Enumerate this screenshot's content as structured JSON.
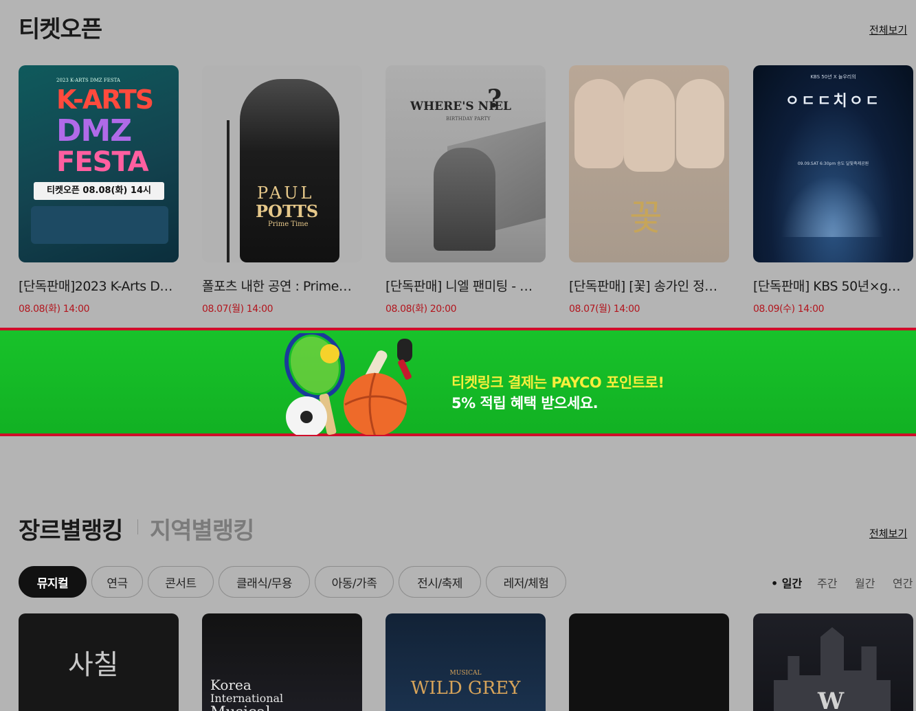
{
  "ticket_open": {
    "title": "티켓오픈",
    "view_all": "전체보기",
    "items": [
      {
        "title": "[단독판매]2023 K-Arts D…",
        "date": "08.08(화) 14:00",
        "poster": {
          "top": "2023 K-ARTS DMZ FESTA",
          "l1": "K-ARTS",
          "l2": "DMZ",
          "l3": "FESTA",
          "open": "티켓오픈 08.08(화) 14시"
        }
      },
      {
        "title": "폴포츠 내한 공연 : Prime…",
        "date": "08.07(월) 14:00",
        "poster": {
          "l1": "PAUL",
          "l2": "POTTS",
          "l3": "Prime Time"
        }
      },
      {
        "title": "[단독판매] 니엘 팬미팅 - …",
        "date": "08.08(화) 20:00",
        "poster": {
          "l1": "WHERE'S NIEL",
          "q": "?",
          "l2": "BIRTHDAY PARTY"
        }
      },
      {
        "title": "[단독판매] [꽃] 송가인 정…",
        "date": "08.07(월) 14:00",
        "poster": {
          "l1": "꽃"
        }
      },
      {
        "title": "[단독판매] KBS 50년×g…",
        "date": "08.09(수) 14:00",
        "poster": {
          "top": "KBS 50년 X 늘우리의",
          "l1": "ㅇㄷㄷ치ㅇㄷ",
          "l2": "09.09.SAT 6:30pm  송도 달빛축제공원"
        }
      }
    ]
  },
  "banner": {
    "line1": "티켓링크 결제는 PAYCO 포인트로!",
    "line2": "5% 적립 혜택 받으세요.",
    "colors": {
      "bg": "#18c22a",
      "border": "#d00d2a",
      "highlight": "#f7ee3c"
    }
  },
  "ranking": {
    "tab_genre": "장르별랭킹",
    "tab_region": "지역별랭킹",
    "view_all": "전체보기",
    "genres": [
      "뮤지컬",
      "연극",
      "콘서트",
      "클래식/무용",
      "아동/가족",
      "전시/축제",
      "레저/체험"
    ],
    "active_genre": "뮤지컬",
    "periods": [
      "• 일간",
      "주간",
      "월간",
      "연간"
    ],
    "active_period": "• 일간",
    "posters": [
      {
        "l1": "사칠"
      },
      {
        "l1": "Korea",
        "l2": "International",
        "l3": "Musical"
      },
      {
        "l1": "WILD GREY",
        "l0": "MUSICAL"
      },
      {
        "l1": ""
      },
      {
        "l1": "W"
      }
    ]
  }
}
